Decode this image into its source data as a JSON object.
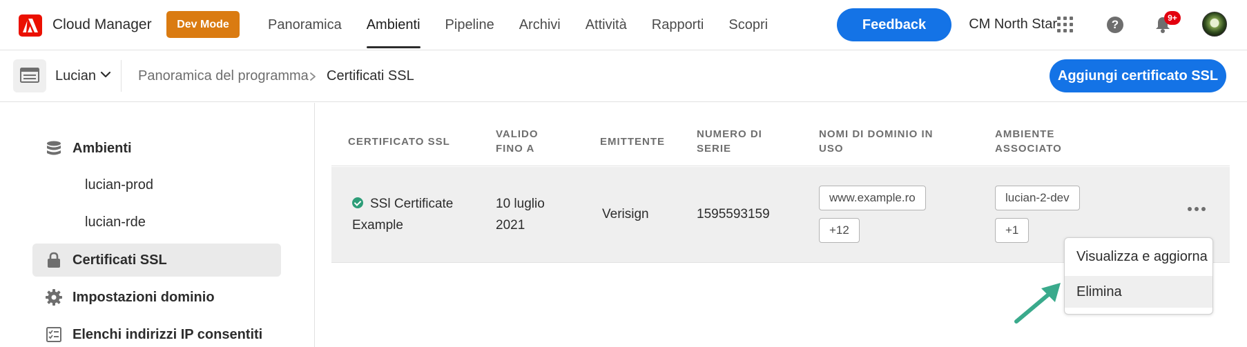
{
  "header": {
    "app_name": "Cloud Manager",
    "dev_mode_label": "Dev Mode",
    "nav": [
      {
        "label": "Panoramica",
        "active": false
      },
      {
        "label": "Ambienti",
        "active": true
      },
      {
        "label": "Pipeline",
        "active": false
      },
      {
        "label": "Archivi",
        "active": false
      },
      {
        "label": "Attività",
        "active": false
      },
      {
        "label": "Rapporti",
        "active": false
      },
      {
        "label": "Scopri",
        "active": false
      }
    ],
    "feedback_label": "Feedback",
    "org_name": "CM North Star",
    "notification_count": "9+",
    "icons": [
      "app-switcher-icon",
      "help-icon",
      "bell-icon",
      "avatar"
    ]
  },
  "subheader": {
    "program_name": "Lucian",
    "breadcrumb_parent": "Panoramica del programma",
    "breadcrumb_current": "Certificati SSL",
    "add_button_label": "Aggiungi certificato SSL"
  },
  "sidebar": {
    "environments_label": "Ambienti",
    "environments": [
      "lucian-prod",
      "lucian-rde"
    ],
    "ssl_label": "Certificati SSL",
    "domain_settings_label": "Impostazioni dominio",
    "ip_allowlists_label": "Elenchi indirizzi IP consentiti"
  },
  "table": {
    "headers": {
      "certificate": "CERTIFICATO SSL",
      "valid_line1": "VALIDO",
      "valid_line2": "FINO A",
      "issuer": "EMITTENTE",
      "serial_line1": "NUMERO DI",
      "serial_line2": "SERIE",
      "domains_line1": "NOMI DI DOMINIO IN",
      "domains_line2": "USO",
      "env_line1": "AMBIENTE",
      "env_line2": "ASSOCIATO"
    },
    "rows": [
      {
        "name_line1": "SSl Certificate",
        "name_line2": "Example",
        "valid_line1": "10 luglio",
        "valid_line2": "2021",
        "issuer": "Verisign",
        "serial": "1595593159",
        "domain_tag": "www.example.ro",
        "domain_more": "+12",
        "env_tag": "lucian-2-dev",
        "env_more": "+1",
        "status": "valid"
      }
    ]
  },
  "menu": {
    "items": [
      "Visualizza e aggiorna",
      "Elimina"
    ],
    "hovered": "Elimina"
  },
  "colors": {
    "accent_blue": "#1473e6",
    "dev_mode_orange": "#da7b11",
    "adobe_red": "#eb1000",
    "status_green": "#2d9d78",
    "annotation_arrow": "#3aaa8c"
  }
}
